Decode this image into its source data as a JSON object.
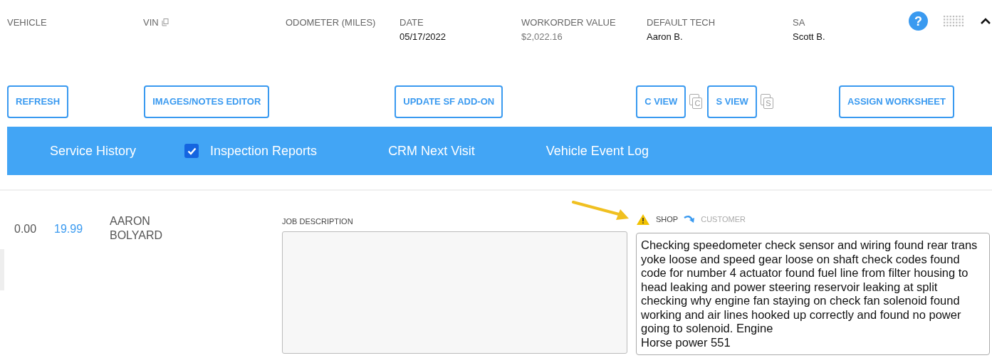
{
  "header_fields": [
    {
      "label": "VEHICLE",
      "kind": "plain"
    },
    {
      "label": "VIN",
      "kind": "copyable"
    },
    {
      "label": "ODOMETER (MILES)",
      "kind": "plain"
    },
    {
      "label": "DATE",
      "value": "05/17/2022",
      "muted": false,
      "kind": "plain"
    },
    {
      "label": "WORKORDER VALUE",
      "value": "$2,022.16",
      "muted": true,
      "kind": "plain"
    },
    {
      "label": "DEFAULT TECH",
      "value": "Aaron B.",
      "muted": false,
      "kind": "plain"
    },
    {
      "label": "SA",
      "value": "Scott B.",
      "muted": false,
      "kind": "plain"
    }
  ],
  "help": {
    "label": "?"
  },
  "buttons": [
    {
      "label": "REFRESH"
    },
    {
      "label": "IMAGES/NOTES EDITOR"
    },
    {
      "label": "UPDATE SF ADD-ON"
    },
    {
      "label": "C VIEW",
      "copy_letter": "C"
    },
    {
      "label": "S VIEW",
      "copy_letter": "S"
    },
    {
      "label": "ASSIGN WORKSHEET"
    }
  ],
  "tabs": [
    {
      "label": "Service History",
      "kind": "plain"
    },
    {
      "label": "Inspection Reports",
      "kind": "checkbox",
      "checked": true
    },
    {
      "label": "CRM Next Visit",
      "kind": "plain"
    },
    {
      "label": "Vehicle Event Log",
      "kind": "plain"
    }
  ],
  "job": {
    "amount": "0.00",
    "price": "19.99",
    "tech": "AARON\nBOLYARD",
    "description_label": "JOB DESCRIPTION",
    "toggle": [
      {
        "label": "SHOP",
        "selected": true
      },
      {
        "label": "CUSTOMER",
        "selected": false
      }
    ],
    "notes": "Checking speedometer check sensor and wiring found rear trans yoke loose and speed gear loose on shaft check codes found code for number 4 actuator found fuel line from filter housing to head leaking and power steering reservoir leaking at split checking why engine fan staying on check fan solenoid found working and air lines hooked up correctly and found no power going to solenoid. Engine\nHorse power 551"
  }
}
